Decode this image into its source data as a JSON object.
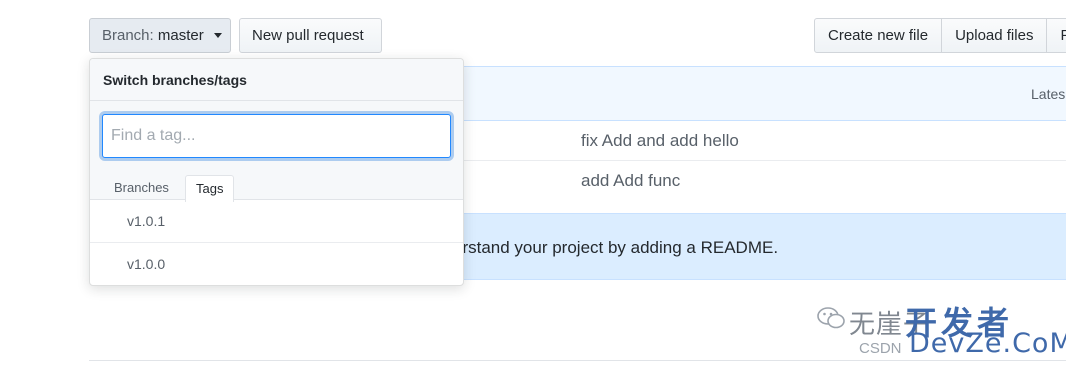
{
  "toolbar": {
    "branch_prefix": "Branch:",
    "branch_name": "master",
    "new_pull_request": "New pull request",
    "create_new_file": "Create new file",
    "upload_files": "Upload files",
    "truncated_button": "F"
  },
  "file_table": {
    "latest_commit_label": "Lates",
    "rows": [
      {
        "message": "fix Add and add hello"
      },
      {
        "message": "add Add func"
      }
    ]
  },
  "readme_banner": {
    "text": "erstand your project by adding a README."
  },
  "dropdown": {
    "title": "Switch branches/tags",
    "search_placeholder": "Find a tag...",
    "tabs": [
      "Branches",
      "Tags"
    ],
    "active_tab": "Tags",
    "items": [
      "v1.0.1",
      "v1.0.0"
    ]
  },
  "watermark": {
    "chinese_text": "无崖子",
    "big_text": "开发者",
    "csdn": "CSDN",
    "devze": "DevZe.CoM"
  },
  "colors": {
    "accent_blue": "#2188ff",
    "banner_blue": "#dbedff",
    "border_blue": "#c8e1ff"
  }
}
